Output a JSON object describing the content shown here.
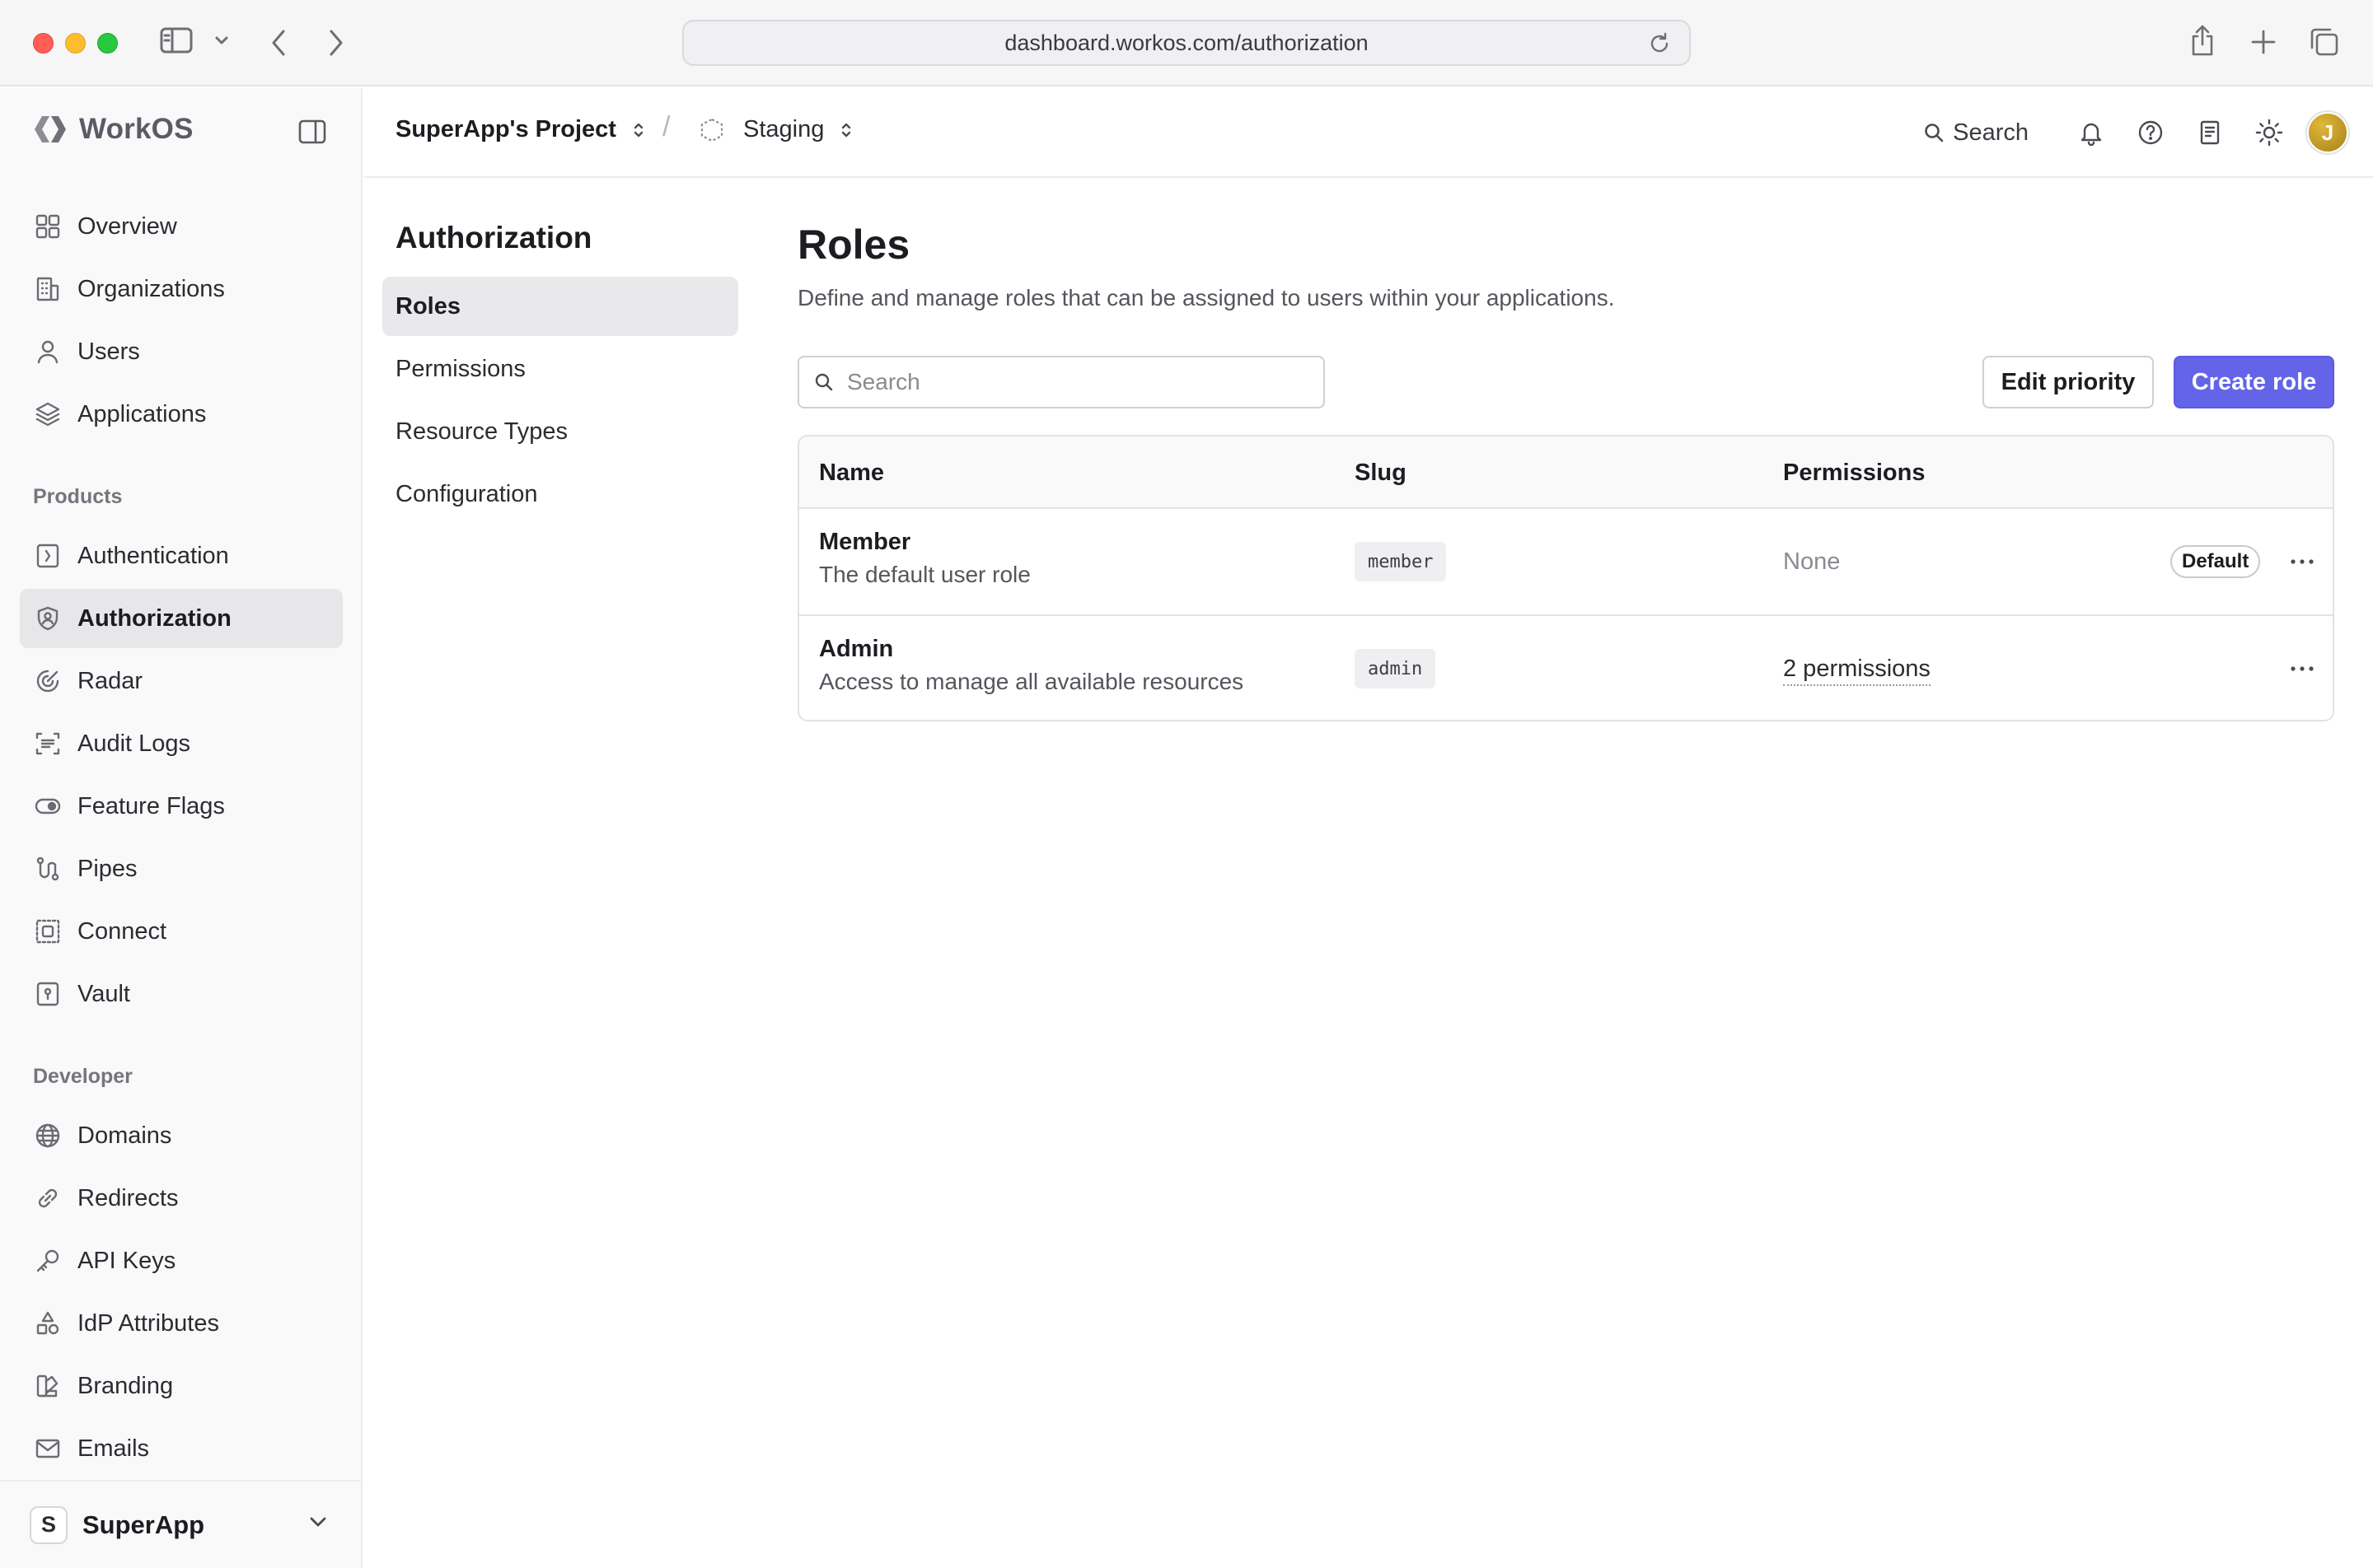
{
  "browser": {
    "url": "dashboard.workos.com/authorization"
  },
  "sidebar": {
    "brand": "WorkOS",
    "main_items": [
      {
        "label": "Overview",
        "icon": "grid-icon"
      },
      {
        "label": "Organizations",
        "icon": "building-icon"
      },
      {
        "label": "Users",
        "icon": "user-icon"
      },
      {
        "label": "Applications",
        "icon": "layers-icon"
      }
    ],
    "products_label": "Products",
    "product_items": [
      {
        "label": "Authentication",
        "icon": "key-door-icon"
      },
      {
        "label": "Authorization",
        "icon": "shield-user-icon",
        "active": true
      },
      {
        "label": "Radar",
        "icon": "radar-icon"
      },
      {
        "label": "Audit Logs",
        "icon": "scan-icon"
      },
      {
        "label": "Feature Flags",
        "icon": "toggle-icon"
      },
      {
        "label": "Pipes",
        "icon": "pipe-icon"
      },
      {
        "label": "Connect",
        "icon": "connect-icon"
      },
      {
        "label": "Vault",
        "icon": "vault-icon"
      }
    ],
    "developer_label": "Developer",
    "developer_items": [
      {
        "label": "Domains",
        "icon": "globe-icon"
      },
      {
        "label": "Redirects",
        "icon": "link-icon"
      },
      {
        "label": "API Keys",
        "icon": "wrench-key-icon"
      },
      {
        "label": "IdP Attributes",
        "icon": "shapes-icon"
      },
      {
        "label": "Branding",
        "icon": "palette-icon"
      },
      {
        "label": "Emails",
        "icon": "mail-icon"
      }
    ],
    "workspace": {
      "initial": "S",
      "name": "SuperApp"
    }
  },
  "header": {
    "project": "SuperApp's Project",
    "separator": "/",
    "environment": "Staging",
    "search_label": "Search"
  },
  "user": {
    "initial": "J"
  },
  "subnav": {
    "title": "Authorization",
    "items": [
      {
        "label": "Roles",
        "active": true
      },
      {
        "label": "Permissions"
      },
      {
        "label": "Resource Types"
      },
      {
        "label": "Configuration"
      }
    ]
  },
  "main": {
    "title": "Roles",
    "description": "Define and manage roles that can be assigned to users within your applications.",
    "search_placeholder": "Search",
    "edit_priority_label": "Edit priority",
    "create_role_label": "Create role",
    "table": {
      "columns": [
        "Name",
        "Slug",
        "Permissions"
      ],
      "rows": [
        {
          "name": "Member",
          "description": "The default user role",
          "slug": "member",
          "permissions": "None",
          "badge": "Default"
        },
        {
          "name": "Admin",
          "description": "Access to manage all available resources",
          "slug": "admin",
          "permissions": "2 permissions"
        }
      ]
    }
  },
  "colors": {
    "accent": "#6364e8",
    "active_bg": "#e7e7ea"
  }
}
